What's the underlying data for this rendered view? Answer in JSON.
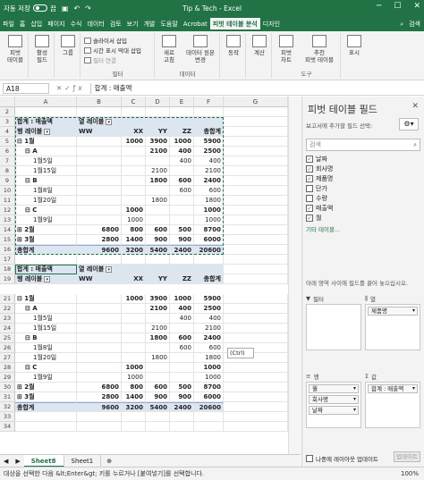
{
  "titlebar": {
    "autosave_label": "자동 저장",
    "autosave_state": "끔",
    "title": "Tip & Tech - Excel"
  },
  "tabs": [
    "파일",
    "홈",
    "삽입",
    "페이지",
    "수식",
    "데이터",
    "검토",
    "보기",
    "개발",
    "도움말",
    "Acrobat",
    "피벗 테이블 분석",
    "디자인"
  ],
  "tabs_right": {
    "search": "검색"
  },
  "ribbon": {
    "pivot_table": "피벗\n테이블",
    "active_field": "활성\n필드",
    "group": "그룹",
    "slicer": "슬라이서 삽입",
    "timeline": "시간 표시 막대 삽입",
    "filter_conn": "필터 연결",
    "refresh": "새로\n고침",
    "change_source": "데이터 원본\n변경",
    "actions": "동작",
    "calc": "계산",
    "pivotchart": "피벗\n차트",
    "recommended": "추천\n피벗 테이블",
    "show": "표시",
    "group_filter": "필터",
    "group_data": "데이터",
    "group_tools": "도구"
  },
  "formula_bar": {
    "namebox": "A18",
    "formula": "합계 : 매출액"
  },
  "columns": [
    "A",
    "B",
    "C",
    "D",
    "E",
    "F",
    "G"
  ],
  "pivot1": {
    "header_row": {
      "sum_label": "합계 : 매출액",
      "col_label": "열 레이블"
    },
    "field_row": {
      "row_label": "행 레이블",
      "cols": [
        "WW",
        "XX",
        "YY",
        "ZZ",
        "총합계"
      ]
    },
    "rows": [
      {
        "n": "5",
        "label": "⊟ 1월",
        "indent": 0,
        "bold": true,
        "vals": [
          "",
          "1000",
          "3900",
          "1000",
          "5900"
        ]
      },
      {
        "n": "6",
        "label": "⊟ A",
        "indent": 1,
        "bold": true,
        "vals": [
          "",
          "",
          "2100",
          "400",
          "2500"
        ]
      },
      {
        "n": "7",
        "label": "1월5일",
        "indent": 2,
        "bold": false,
        "vals": [
          "",
          "",
          "",
          "400",
          "400"
        ]
      },
      {
        "n": "8",
        "label": "1월15일",
        "indent": 2,
        "bold": false,
        "vals": [
          "",
          "",
          "2100",
          "",
          "2100"
        ]
      },
      {
        "n": "9",
        "label": "⊟ B",
        "indent": 1,
        "bold": true,
        "vals": [
          "",
          "",
          "1800",
          "600",
          "2400"
        ]
      },
      {
        "n": "10",
        "label": "1월8일",
        "indent": 2,
        "bold": false,
        "vals": [
          "",
          "",
          "",
          "600",
          "600"
        ]
      },
      {
        "n": "11",
        "label": "1월20일",
        "indent": 2,
        "bold": false,
        "vals": [
          "",
          "",
          "1800",
          "",
          "1800"
        ]
      },
      {
        "n": "12",
        "label": "⊟ C",
        "indent": 1,
        "bold": true,
        "vals": [
          "",
          "1000",
          "",
          "",
          "1000"
        ]
      },
      {
        "n": "13",
        "label": "1월9일",
        "indent": 2,
        "bold": false,
        "vals": [
          "",
          "1000",
          "",
          "",
          "1000"
        ]
      },
      {
        "n": "14",
        "label": "⊞ 2월",
        "indent": 0,
        "bold": true,
        "vals": [
          "6800",
          "800",
          "600",
          "500",
          "8700"
        ]
      },
      {
        "n": "15",
        "label": "⊞ 3월",
        "indent": 0,
        "bold": true,
        "vals": [
          "2800",
          "1400",
          "900",
          "900",
          "6000"
        ]
      }
    ],
    "total": {
      "n": "16",
      "label": "총합계",
      "vals": [
        "9600",
        "3200",
        "5400",
        "2400",
        "20600"
      ]
    }
  },
  "pivot2": {
    "header_row": {
      "sum_label": "합계 : 매출액",
      "col_label": "열 레이블"
    },
    "field_row": {
      "row_label": "행 레이블",
      "cols": [
        "WW",
        "XX",
        "YY",
        "ZZ",
        "총합계"
      ]
    },
    "rows": [
      {
        "n": "21",
        "label": "⊟ 1월",
        "indent": 0,
        "bold": true,
        "vals": [
          "",
          "1000",
          "3900",
          "1000",
          "5900"
        ]
      },
      {
        "n": "22",
        "label": "⊟ A",
        "indent": 1,
        "bold": true,
        "vals": [
          "",
          "",
          "2100",
          "400",
          "2500"
        ]
      },
      {
        "n": "23",
        "label": "1월5일",
        "indent": 2,
        "bold": false,
        "vals": [
          "",
          "",
          "",
          "400",
          "400"
        ]
      },
      {
        "n": "24",
        "label": "1월15일",
        "indent": 2,
        "bold": false,
        "vals": [
          "",
          "",
          "2100",
          "",
          "2100"
        ]
      },
      {
        "n": "25",
        "label": "⊟ B",
        "indent": 1,
        "bold": true,
        "vals": [
          "",
          "",
          "1800",
          "600",
          "2400"
        ]
      },
      {
        "n": "26",
        "label": "1월8일",
        "indent": 2,
        "bold": false,
        "vals": [
          "",
          "",
          "",
          "600",
          "600"
        ]
      },
      {
        "n": "27",
        "label": "1월20일",
        "indent": 2,
        "bold": false,
        "vals": [
          "",
          "",
          "1800",
          "",
          "1800"
        ]
      },
      {
        "n": "28",
        "label": "⊟ C",
        "indent": 1,
        "bold": true,
        "vals": [
          "",
          "1000",
          "",
          "",
          "1000"
        ]
      },
      {
        "n": "29",
        "label": "1월9일",
        "indent": 2,
        "bold": false,
        "vals": [
          "",
          "1000",
          "",
          "",
          "1000"
        ]
      },
      {
        "n": "30",
        "label": "⊞ 2월",
        "indent": 0,
        "bold": true,
        "vals": [
          "6800",
          "800",
          "600",
          "500",
          "8700"
        ]
      },
      {
        "n": "31",
        "label": "⊞ 3월",
        "indent": 0,
        "bold": true,
        "vals": [
          "2800",
          "1400",
          "900",
          "900",
          "6000"
        ]
      }
    ],
    "total": {
      "n": "32",
      "label": "총합계",
      "vals": [
        "9600",
        "3200",
        "5400",
        "2400",
        "20600"
      ]
    }
  },
  "paste_badge": "(Ctrl)",
  "sheets": {
    "active": "Sheet8",
    "other": "Sheet1"
  },
  "status": {
    "message": "대상을 선택한 다음 &lt;Enter&gt; 키를 누르거나 [붙여넣기]를 선택합니다.",
    "zoom": "100%"
  },
  "pane": {
    "title": "피벗 테이블 필드",
    "subtitle": "보고서에 추가할 필드 선택:",
    "search_placeholder": "검색",
    "fields": [
      {
        "name": "날짜",
        "checked": true
      },
      {
        "name": "회사명",
        "checked": true
      },
      {
        "name": "제품명",
        "checked": true
      },
      {
        "name": "단가",
        "checked": false
      },
      {
        "name": "수량",
        "checked": false
      },
      {
        "name": "매출액",
        "checked": true
      },
      {
        "name": "월",
        "checked": true
      }
    ],
    "more_tables": "기타 테이블...",
    "drag_note": "아래 영역 사이에 필드를 끌어 놓으십시오.",
    "area_filter": "필터",
    "area_columns": "열",
    "area_rows": "행",
    "area_values": "값",
    "columns_items": [
      "제품명"
    ],
    "rows_items": [
      "월",
      "회사명",
      "날짜"
    ],
    "values_items": [
      "합계 : 매출액"
    ],
    "defer_label": "나중에 레이아웃 업데이트",
    "update_button": "업데이트"
  }
}
